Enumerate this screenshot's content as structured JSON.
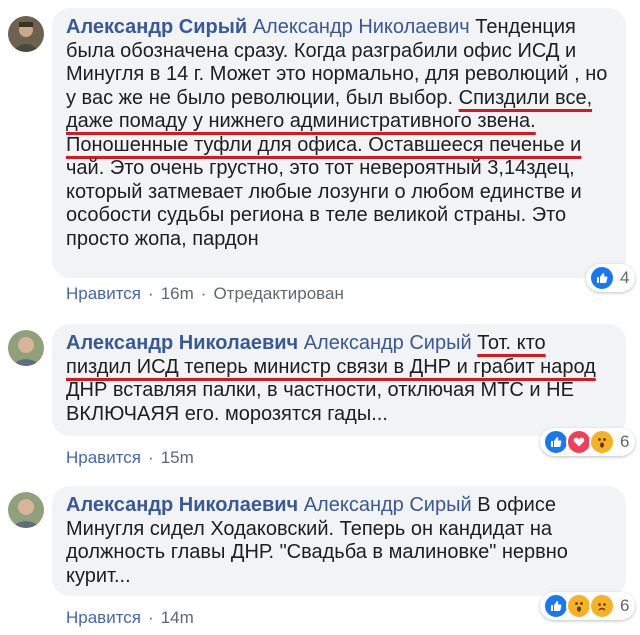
{
  "comments": [
    {
      "author": "Александр Сирый",
      "mention": "Александр Николаевич",
      "text_1": "Тенденция была обозначена сразу. Когда разграбили офис ИСД и Минугля в 14 г. Может это нормально, для революций , но у вас же не было революции, был выбор.",
      "text_hl_1": "Спиздили все, даже помаду у нижнего административного звена. Поношенные туфли для офиса. Оставшееся печенье и",
      "text_2": "чай. Это очень грустно, это тот невероятный 3,14здец, который затмевает любые лозунги о любом единстве и особости судьбы региона в теле великой страны. Это просто жопа, пардон",
      "like_label": "Нравится",
      "time": "16m",
      "edited": "Отредактирован",
      "reaction_count": "4",
      "reaction_icons": [
        "like-icon"
      ]
    },
    {
      "author": "Александр Николаевич",
      "mention": "Александр Сирый",
      "text_hl_1": "Тот. кто пиздил ИСД теперь министр связи в ДНР и грабит народ",
      "text_2": "ДНР вставляя палки, в частности, отключая МТС и НЕ ВКЛЮЧАЯЯ его. морозятся гады...",
      "like_label": "Нравится",
      "time": "15m",
      "reaction_count": "6",
      "reaction_icons": [
        "like-icon",
        "love-icon",
        "wow-icon"
      ]
    },
    {
      "author": "Александр Николаевич",
      "mention": "Александр Сирый",
      "text_1": "В офисе Минугля сидел Ходаковский. Теперь он кандидат на должность главы ДНР. \"Свадьба в малиновке\" нервно курит...",
      "like_label": "Нравится",
      "time": "14m",
      "reaction_count": "6",
      "reaction_icons": [
        "like-icon",
        "wow-icon",
        "sad-icon"
      ]
    }
  ],
  "colors": {
    "link": "#385898",
    "bubble": "#f2f3f5",
    "underline": "#d7191f",
    "meta": "#606770"
  }
}
